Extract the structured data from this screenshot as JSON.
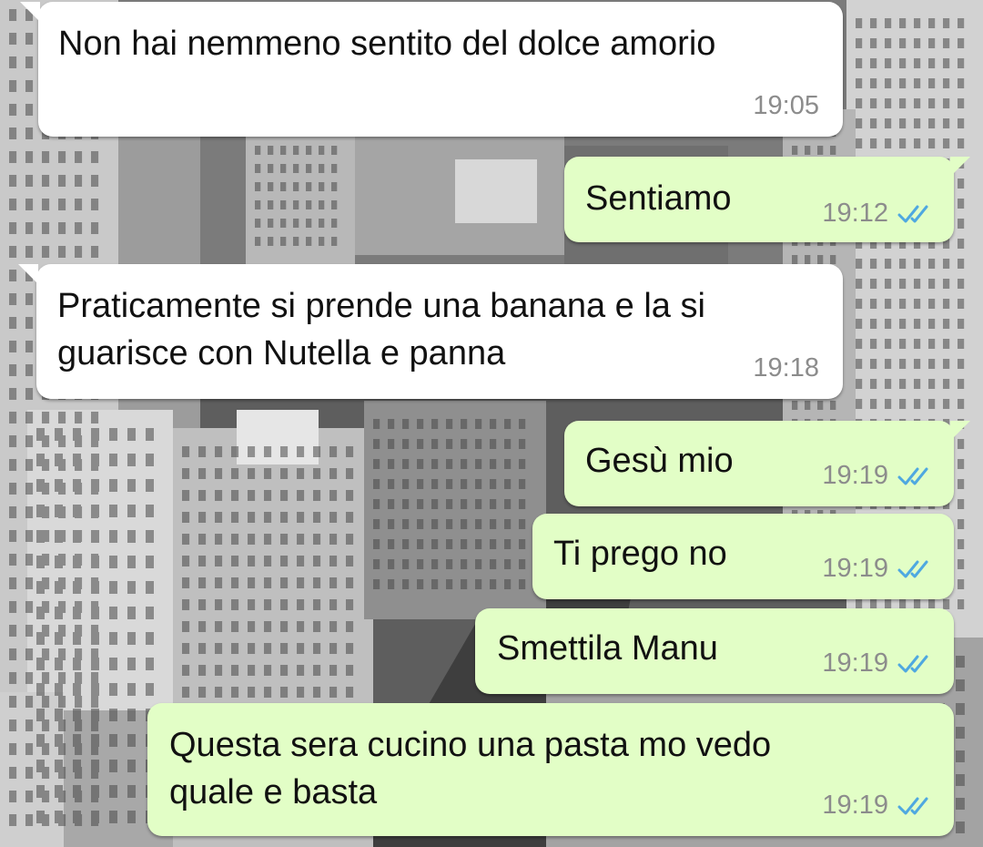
{
  "colors": {
    "incoming_bubble": "#ffffff",
    "outgoing_bubble": "#e2fec6",
    "text": "#111111",
    "timestamp": "#8c8c8c",
    "read_ticks": "#4fa8e0"
  },
  "wallpaper": {
    "style": "black-and-white city skyline"
  },
  "messages": [
    {
      "direction": "incoming",
      "lines": [
        "Non hai nemmeno sentito del dolce amorio"
      ],
      "time": "19:05"
    },
    {
      "direction": "outgoing",
      "lines": [
        "Sentiamo"
      ],
      "time": "19:12",
      "status_icon": "double-check-read-icon"
    },
    {
      "direction": "incoming",
      "lines": [
        "Praticamente si prende una banana e la si",
        "guarisce con Nutella e panna"
      ],
      "time": "19:18"
    },
    {
      "direction": "outgoing",
      "lines": [
        "Gesù mio"
      ],
      "time": "19:19",
      "status_icon": "double-check-read-icon"
    },
    {
      "direction": "outgoing",
      "lines": [
        "Ti prego no"
      ],
      "time": "19:19",
      "status_icon": "double-check-read-icon"
    },
    {
      "direction": "outgoing",
      "lines": [
        "Smettila Manu"
      ],
      "time": "19:19",
      "status_icon": "double-check-read-icon"
    },
    {
      "direction": "outgoing",
      "lines": [
        "Questa sera cucino una pasta mo vedo",
        "quale e basta"
      ],
      "time": "19:19",
      "status_icon": "double-check-read-icon"
    }
  ]
}
